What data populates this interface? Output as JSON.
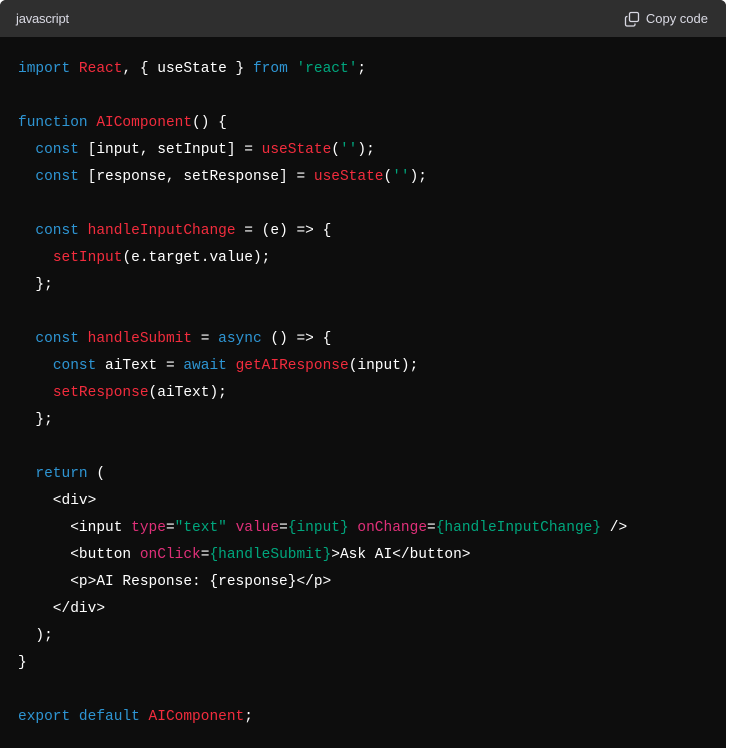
{
  "header": {
    "language": "javascript",
    "copy_label": "Copy code",
    "copy_icon": "copy-icon"
  },
  "colors": {
    "header_bg": "#2f2f2f",
    "code_bg": "#0d0d0d",
    "keyword": "#2e95d3",
    "function": "#f22c3d",
    "string": "#00a67d",
    "attribute": "#df3079",
    "plain": "#ffffff"
  },
  "code_lines": [
    [
      [
        "kw",
        "import"
      ],
      [
        "pl",
        " "
      ],
      [
        "fn",
        "React"
      ],
      [
        "pl",
        ", { useState } "
      ],
      [
        "kw",
        "from"
      ],
      [
        "pl",
        " "
      ],
      [
        "str",
        "'react'"
      ],
      [
        "pl",
        ";"
      ]
    ],
    [],
    [
      [
        "kw",
        "function"
      ],
      [
        "pl",
        " "
      ],
      [
        "fn",
        "AIComponent"
      ],
      [
        "pl",
        "() {"
      ]
    ],
    [
      [
        "pl",
        "  "
      ],
      [
        "kw",
        "const"
      ],
      [
        "pl",
        " [input, setInput] = "
      ],
      [
        "fn",
        "useState"
      ],
      [
        "pl",
        "("
      ],
      [
        "str",
        "''"
      ],
      [
        "pl",
        ");"
      ]
    ],
    [
      [
        "pl",
        "  "
      ],
      [
        "kw",
        "const"
      ],
      [
        "pl",
        " [response, setResponse] = "
      ],
      [
        "fn",
        "useState"
      ],
      [
        "pl",
        "("
      ],
      [
        "str",
        "''"
      ],
      [
        "pl",
        ");"
      ]
    ],
    [],
    [
      [
        "pl",
        "  "
      ],
      [
        "kw",
        "const"
      ],
      [
        "pl",
        " "
      ],
      [
        "fn",
        "handleInputChange"
      ],
      [
        "pl",
        " = (e) => {"
      ]
    ],
    [
      [
        "pl",
        "    "
      ],
      [
        "fn",
        "setInput"
      ],
      [
        "pl",
        "(e.target.value);"
      ]
    ],
    [
      [
        "pl",
        "  };"
      ]
    ],
    [],
    [
      [
        "pl",
        "  "
      ],
      [
        "kw",
        "const"
      ],
      [
        "pl",
        " "
      ],
      [
        "fn",
        "handleSubmit"
      ],
      [
        "pl",
        " = "
      ],
      [
        "kw",
        "async"
      ],
      [
        "pl",
        " () => {"
      ]
    ],
    [
      [
        "pl",
        "    "
      ],
      [
        "kw",
        "const"
      ],
      [
        "pl",
        " aiText = "
      ],
      [
        "kw",
        "await"
      ],
      [
        "pl",
        " "
      ],
      [
        "fn",
        "getAIResponse"
      ],
      [
        "pl",
        "(input);"
      ]
    ],
    [
      [
        "pl",
        "    "
      ],
      [
        "fn",
        "setResponse"
      ],
      [
        "pl",
        "(aiText);"
      ]
    ],
    [
      [
        "pl",
        "  };"
      ]
    ],
    [],
    [
      [
        "pl",
        "  "
      ],
      [
        "kw",
        "return"
      ],
      [
        "pl",
        " ("
      ]
    ],
    [
      [
        "pl",
        "    <div>"
      ]
    ],
    [
      [
        "pl",
        "      <input "
      ],
      [
        "attr",
        "type"
      ],
      [
        "pl",
        "="
      ],
      [
        "str",
        "\"text\""
      ],
      [
        "pl",
        " "
      ],
      [
        "attr",
        "value"
      ],
      [
        "pl",
        "="
      ],
      [
        "str",
        "{input}"
      ],
      [
        "pl",
        " "
      ],
      [
        "attr",
        "onChange"
      ],
      [
        "pl",
        "="
      ],
      [
        "str",
        "{handleInputChange}"
      ],
      [
        "pl",
        " />"
      ]
    ],
    [
      [
        "pl",
        "      <button "
      ],
      [
        "attr",
        "onClick"
      ],
      [
        "pl",
        "="
      ],
      [
        "str",
        "{handleSubmit}"
      ],
      [
        "pl",
        ">Ask AI</button>"
      ]
    ],
    [
      [
        "pl",
        "      <p>AI Response: {response}</p>"
      ]
    ],
    [
      [
        "pl",
        "    </div>"
      ]
    ],
    [
      [
        "pl",
        "  );"
      ]
    ],
    [
      [
        "pl",
        "}"
      ]
    ],
    [],
    [
      [
        "kw",
        "export"
      ],
      [
        "pl",
        " "
      ],
      [
        "kw",
        "default"
      ],
      [
        "pl",
        " "
      ],
      [
        "fn",
        "AIComponent"
      ],
      [
        "pl",
        ";"
      ]
    ]
  ]
}
